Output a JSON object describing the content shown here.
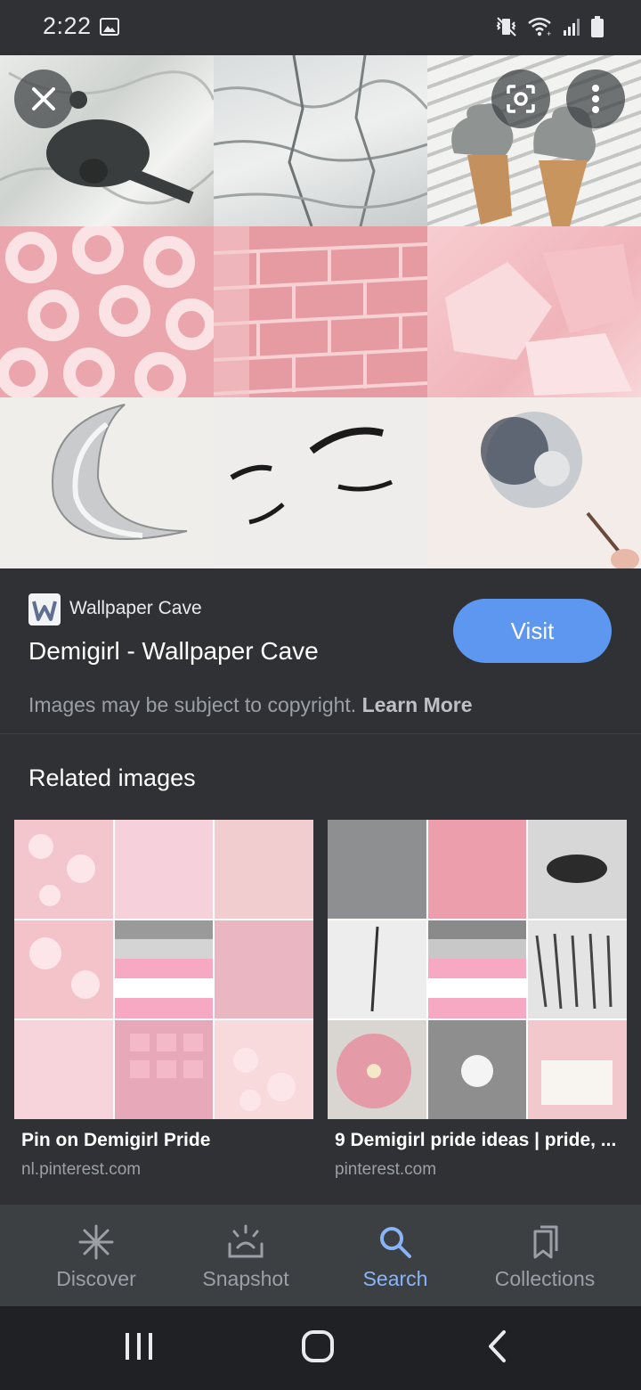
{
  "status": {
    "time": "2:22"
  },
  "source": {
    "name": "Wallpaper Cave"
  },
  "result": {
    "title": "Demigirl - Wallpaper Cave",
    "visit_label": "Visit",
    "copyright": "Images may be subject to copyright.",
    "learn_more": "Learn More"
  },
  "related": {
    "heading": "Related images",
    "items": [
      {
        "caption": "Pin on Demigirl Pride",
        "domain": "nl.pinterest.com"
      },
      {
        "caption": "9 Demigirl pride ideas | pride, ...",
        "domain": "pinterest.com"
      }
    ]
  },
  "nav": {
    "items": [
      {
        "label": "Discover",
        "icon": "asterisk-icon"
      },
      {
        "label": "Snapshot",
        "icon": "snapshot-icon"
      },
      {
        "label": "Search",
        "icon": "search-icon",
        "active": true
      },
      {
        "label": "Collections",
        "icon": "bookmarks-icon"
      }
    ]
  },
  "colors": {
    "accent": "#8ab4f8",
    "visit_button": "#5e97f0",
    "background": "#303134"
  }
}
